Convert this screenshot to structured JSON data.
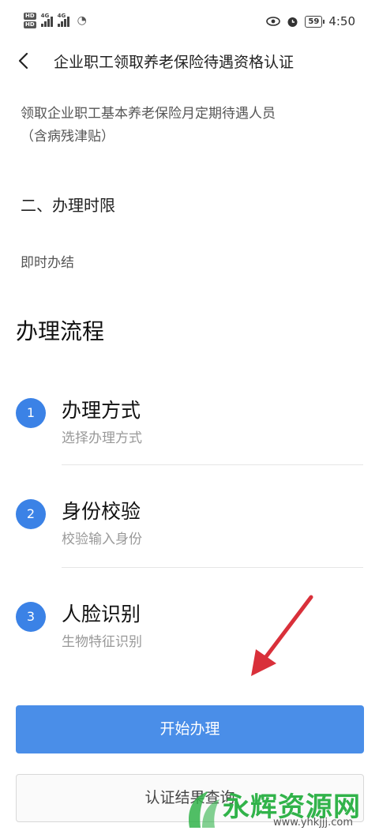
{
  "status_bar": {
    "hd_labels": [
      "HD",
      "HD"
    ],
    "network": [
      "4G",
      "4G"
    ],
    "battery": "59",
    "time": "4:50",
    "icons": [
      "eye-icon",
      "alarm-icon",
      "battery-icon",
      "wifi-icon",
      "signal-icon"
    ]
  },
  "header": {
    "back_icon": "chevron-left-icon",
    "title": "企业职工领取养老保险待遇资格认证"
  },
  "content": {
    "intro_line1": "领取企业职工基本养老保险月定期待遇人员",
    "intro_line2": "（含病残津贴）",
    "section_title": "二、办理时限",
    "section_value": "即时办结"
  },
  "process": {
    "title": "办理流程",
    "steps": [
      {
        "number": "1",
        "title": "办理方式",
        "subtitle": "选择办理方式"
      },
      {
        "number": "2",
        "title": "身份校验",
        "subtitle": "校验输入身份"
      },
      {
        "number": "3",
        "title": "人脸识别",
        "subtitle": "生物特征识别"
      }
    ]
  },
  "actions": {
    "start_label": "开始办理",
    "query_label": "认证结果查询"
  },
  "watermark": {
    "text": "永辉资源网",
    "url": "www.yhkjjj.com"
  },
  "colors": {
    "accent": "#4a8ee8",
    "step_circle": "#3b82e6",
    "arrow": "#d9303a",
    "watermark": "#31b34a"
  }
}
